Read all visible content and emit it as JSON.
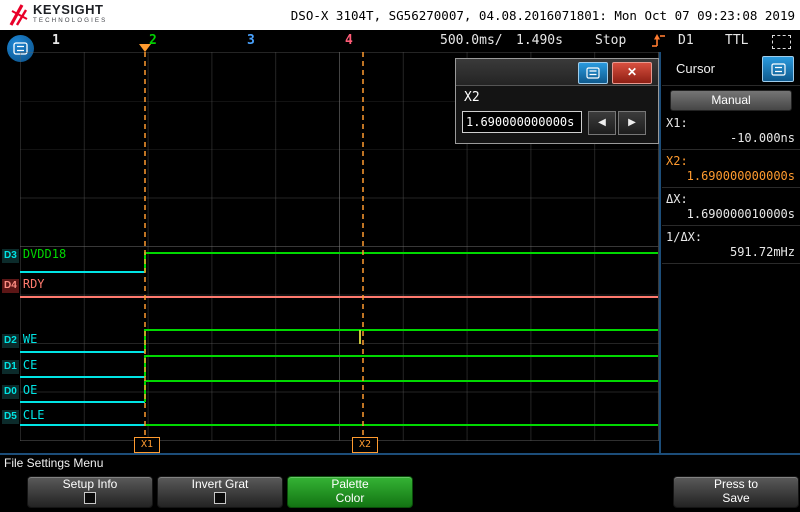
{
  "header": {
    "brand_name": "KEYSIGHT",
    "brand_sub": "TECHNOLOGIES",
    "title": "DSO-X 3104T, SG56270007, 04.08.2016071801: Mon Oct 07 09:23:08 2019"
  },
  "statusbar": {
    "channel_1": "1",
    "channel_2": "2",
    "channel_3": "3",
    "channel_4": "4",
    "timebase": "500.0ms/",
    "delay": "1.490s",
    "run_state": "Stop",
    "trigger_source": "D1",
    "trigger_mode": "TTL"
  },
  "dialog": {
    "field_label": "X2",
    "field_value": "1.690000000000s",
    "prev_icon": "◀",
    "next_icon": "▶",
    "close_icon": "✕"
  },
  "cursor_panel": {
    "title": "Cursor",
    "mode_button": "Manual",
    "rows": [
      {
        "label": "X1:",
        "value": "-10.000ns"
      },
      {
        "label": "X2:",
        "value": "1.690000000000s"
      },
      {
        "label": "ΔX:",
        "value": "1.690000010000s"
      },
      {
        "label": "1/ΔX:",
        "value": "591.72mHz"
      }
    ]
  },
  "waveform": {
    "channels": [
      {
        "badge": "D3",
        "name": "DVDD18"
      },
      {
        "badge": "D4",
        "name": "RDY"
      },
      {
        "badge": "D2",
        "name": "WE"
      },
      {
        "badge": "D1",
        "name": "CE"
      },
      {
        "badge": "D0",
        "name": "OE"
      },
      {
        "badge": "D5",
        "name": "CLE"
      }
    ],
    "cursor_tags": [
      {
        "label": "X1"
      },
      {
        "label": "X2"
      }
    ]
  },
  "footer": {
    "menu_title": "File Settings Menu",
    "softkeys": [
      {
        "label": "Setup Info"
      },
      {
        "label": "Invert Grat"
      },
      {
        "line1": "Palette",
        "line2": "Color"
      },
      {
        "line1": "Press to",
        "line2": "Save"
      }
    ]
  },
  "colors": {
    "accent_orange": "#ff9b2f",
    "trace_green": "#00d800",
    "trace_cyan": "#00e5e5",
    "trace_red": "#ff7a6e",
    "channel2_green": "#00d000",
    "channel3_blue": "#4aa3ff",
    "channel4_red": "#ff5c77",
    "menu_blue": "#1f8fd0",
    "close_red": "#c0342a",
    "palette_green": "#28a428",
    "keysight_red": "#e90029"
  }
}
